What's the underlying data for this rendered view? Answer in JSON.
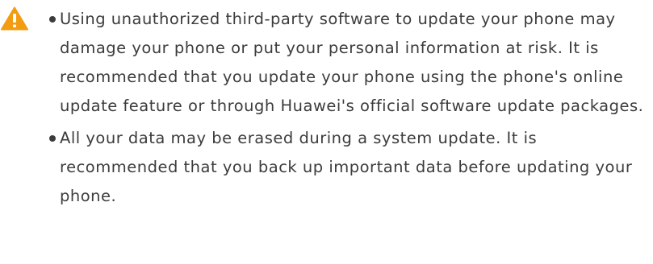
{
  "notice": {
    "icon": "warning-triangle-icon",
    "icon_color": "#f39c12",
    "text_color": "#3c3c3c",
    "bullets": [
      {
        "text": "Using unauthorized third-party software to update your phone may damage your phone or put your personal information at risk. It is recommended that you update your phone using the phone's online update feature or through Huawei's official software update packages."
      },
      {
        "text": "All your data may be erased during a system update. It is recommended that you back up important data before updating your phone."
      }
    ]
  }
}
